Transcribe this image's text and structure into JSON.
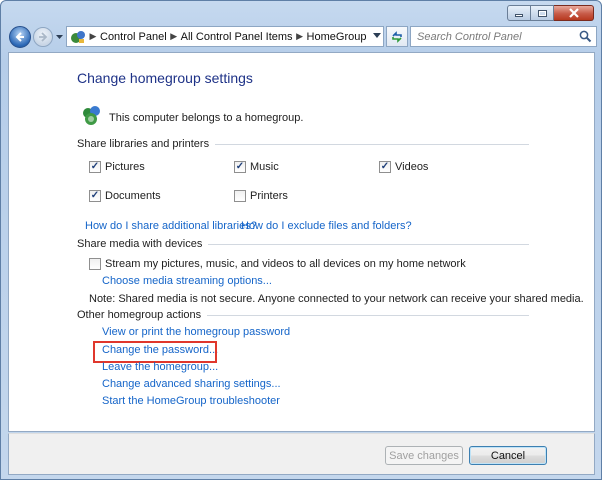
{
  "address_bar": {
    "crumbs": [
      "Control Panel",
      "All Control Panel Items",
      "HomeGroup"
    ]
  },
  "search": {
    "placeholder": "Search Control Panel"
  },
  "page": {
    "title": "Change homegroup settings",
    "belongs_text": "This computer belongs to a homegroup."
  },
  "share_libraries": {
    "heading": "Share libraries and printers",
    "items": [
      {
        "label": "Pictures",
        "checked": true
      },
      {
        "label": "Music",
        "checked": true
      },
      {
        "label": "Videos",
        "checked": true
      },
      {
        "label": "Documents",
        "checked": true
      },
      {
        "label": "Printers",
        "checked": false
      }
    ],
    "links": [
      "How do I share additional libraries?",
      "How do I exclude files and folders?"
    ]
  },
  "share_media": {
    "heading": "Share media with devices",
    "stream_label": "Stream my pictures, music, and videos to all devices on my home network",
    "stream_checked": false,
    "options_link": "Choose media streaming options...",
    "note": "Note: Shared media is not secure. Anyone connected to your network can receive your shared media."
  },
  "other_actions": {
    "heading": "Other homegroup actions",
    "links": [
      "View or print the homegroup password",
      "Change the password...",
      "Leave the homegroup...",
      "Change advanced sharing settings...",
      "Start the HomeGroup troubleshooter"
    ]
  },
  "footer": {
    "save_label": "Save changes",
    "cancel_label": "Cancel"
  },
  "colors": {
    "title": "#1e3287",
    "link": "#1565c9",
    "highlight": "#e0372c"
  }
}
